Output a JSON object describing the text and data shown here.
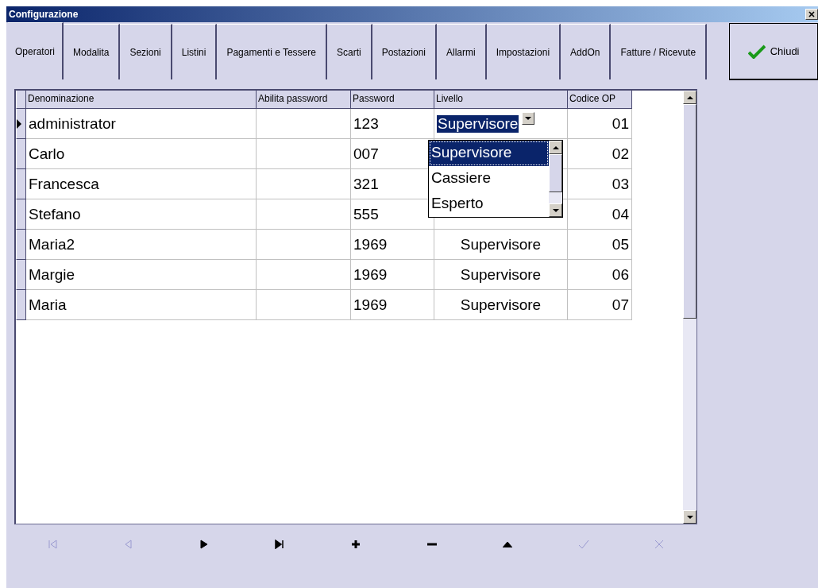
{
  "window": {
    "title": "Configurazione"
  },
  "tabs": [
    {
      "label": "Operatori",
      "selected": true
    },
    {
      "label": "Modalita",
      "selected": false
    },
    {
      "label": "Sezioni",
      "selected": false
    },
    {
      "label": "Listini",
      "selected": false
    },
    {
      "label": "Pagamenti e Tessere",
      "selected": false
    },
    {
      "label": "Scarti",
      "selected": false
    },
    {
      "label": "Postazioni",
      "selected": false
    },
    {
      "label": "Allarmi",
      "selected": false
    },
    {
      "label": "Impostazioni",
      "selected": false
    },
    {
      "label": "AddOn",
      "selected": false
    },
    {
      "label": "Fatture / Ricevute",
      "selected": false
    }
  ],
  "close_button": {
    "label": "Chiudi"
  },
  "table": {
    "columns": [
      "Denominazione",
      "Abilita password",
      "Password",
      "Livello",
      "Codice OP"
    ],
    "rows": [
      {
        "denominazione": "administrator",
        "password": "123",
        "livello": "Supervisore",
        "codice": "01",
        "selected": true
      },
      {
        "denominazione": "Carlo",
        "password": "007",
        "codice": "02",
        "selected": false
      },
      {
        "denominazione": "Francesca",
        "password": "321",
        "codice": "03",
        "selected": false
      },
      {
        "denominazione": "Stefano",
        "password": "555",
        "codice": "04",
        "selected": false
      },
      {
        "denominazione": "Maria2",
        "password": "1969",
        "livello": "Supervisore",
        "codice": "05",
        "selected": false
      },
      {
        "denominazione": "Margie",
        "password": "1969",
        "livello": "Supervisore",
        "codice": "06",
        "selected": false
      },
      {
        "denominazione": "Maria",
        "password": "1969",
        "livello": "Supervisore",
        "codice": "07",
        "selected": false
      }
    ],
    "dropdown": {
      "options": [
        {
          "label": "Supervisore",
          "selected": true
        },
        {
          "label": "Cassiere",
          "selected": false
        },
        {
          "label": "Esperto",
          "selected": false
        }
      ]
    }
  },
  "navigator": [
    {
      "kind": "first",
      "disabled": true
    },
    {
      "kind": "prior",
      "disabled": true
    },
    {
      "kind": "next",
      "disabled": false
    },
    {
      "kind": "last",
      "disabled": false
    },
    {
      "kind": "insert",
      "disabled": false
    },
    {
      "kind": "delete",
      "disabled": false
    },
    {
      "kind": "edit",
      "disabled": false
    },
    {
      "kind": "post",
      "disabled": true
    },
    {
      "kind": "cancel",
      "disabled": true
    }
  ]
}
